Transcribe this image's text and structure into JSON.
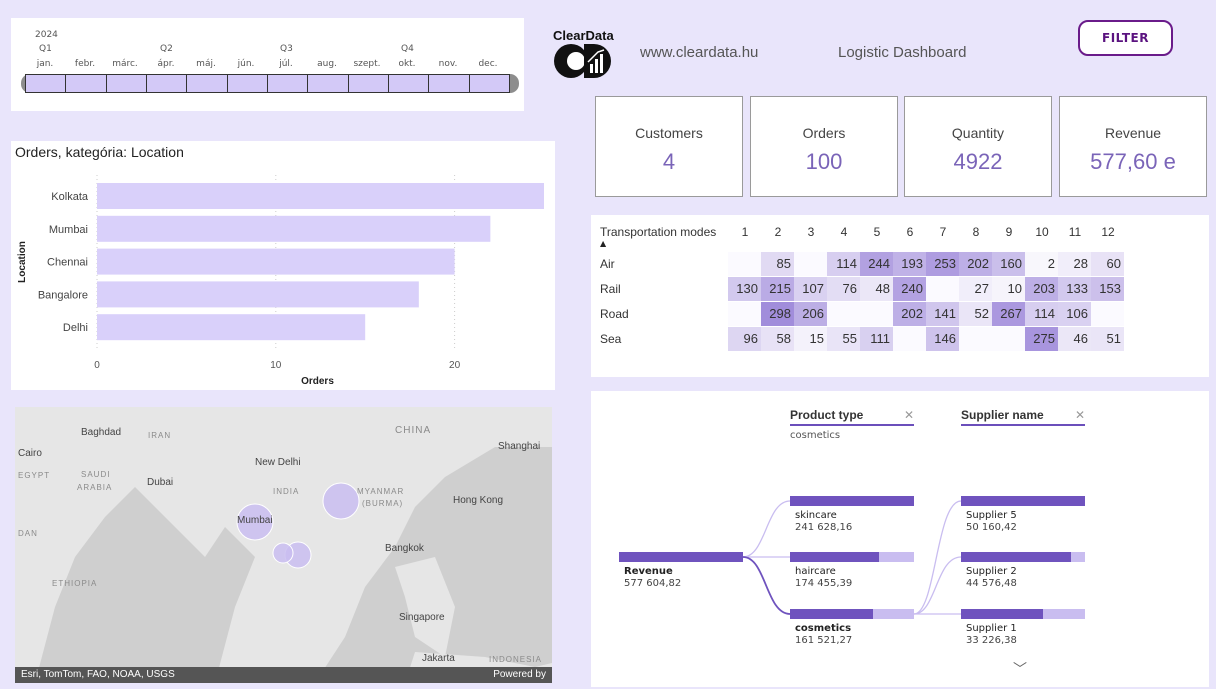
{
  "timeline": {
    "year": "2024",
    "quarters": [
      "Q1",
      "Q2",
      "Q3",
      "Q4"
    ],
    "months": [
      "jan.",
      "febr.",
      "márc.",
      "ápr.",
      "máj.",
      "jún.",
      "júl.",
      "aug.",
      "szept.",
      "okt.",
      "nov.",
      "dec."
    ]
  },
  "header": {
    "logo_text": "ClearData",
    "url": "www.cleardata.hu",
    "title": "Logistic Dashboard",
    "filter_label": "FILTER"
  },
  "kpis": [
    {
      "label": "Customers",
      "value": "4"
    },
    {
      "label": "Orders",
      "value": "100"
    },
    {
      "label": "Quantity",
      "value": "4922"
    },
    {
      "label": "Revenue",
      "value": "577,60 e"
    }
  ],
  "chart_data": {
    "type": "bar",
    "orientation": "horizontal",
    "title": "Orders, kategória: Location",
    "xlabel": "Orders",
    "ylabel": "Location",
    "categories": [
      "Kolkata",
      "Mumbai",
      "Chennai",
      "Bangalore",
      "Delhi"
    ],
    "values": [
      25,
      22,
      20,
      18,
      15
    ],
    "xlim": [
      0,
      25
    ],
    "xticks": [
      "0",
      "10",
      "20"
    ],
    "grid": true,
    "bar_color": "#d9d0fa"
  },
  "heatmap": {
    "header_label": "Transportation modes",
    "columns": [
      "1",
      "2",
      "3",
      "4",
      "5",
      "6",
      "7",
      "8",
      "9",
      "10",
      "11",
      "12"
    ],
    "rows": [
      {
        "label": "Air",
        "values": [
          "",
          "85",
          "",
          "114",
          "244",
          "193",
          "253",
          "202",
          "160",
          "2",
          "28",
          "60"
        ]
      },
      {
        "label": "Rail",
        "values": [
          "130",
          "215",
          "107",
          "76",
          "48",
          "240",
          "",
          "27",
          "10",
          "203",
          "133",
          "153"
        ]
      },
      {
        "label": "Road",
        "values": [
          "",
          "298",
          "206",
          "",
          "",
          "202",
          "141",
          "52",
          "267",
          "114",
          "106",
          ""
        ]
      },
      {
        "label": "Sea",
        "values": [
          "96",
          "58",
          "15",
          "55",
          "111",
          "",
          "146",
          "",
          "",
          "275",
          "46",
          "51"
        ]
      }
    ]
  },
  "map": {
    "labels": {
      "baghdad": "Baghdad",
      "iran": "IRAN",
      "china": "CHINA",
      "cairo": "Cairo",
      "egypt": "EGYPT",
      "saudi": "SAUDI",
      "arabia": "ARABIA",
      "dubai": "Dubai",
      "new_delhi": "New Delhi",
      "india": "INDIA",
      "myanmar": "MYANMAR",
      "burma": "(BURMA)",
      "shanghai": "Shanghai",
      "hong_kong": "Hong Kong",
      "mumbai": "Mumbai",
      "dan": "DAN",
      "ethiopia": "ETHIOPIA",
      "bangkok": "Bangkok",
      "singapore": "Singapore",
      "jakarta": "Jakarta",
      "indonesia": "INDONESIA"
    },
    "attribution": "Esri, TomTom, FAO, NOAA, USGS",
    "powered_by": "Powered by"
  },
  "tree": {
    "filters": [
      {
        "label": "Product type",
        "selected": "cosmetics"
      },
      {
        "label": "Supplier name",
        "selected": ""
      }
    ],
    "root": {
      "name": "Revenue",
      "value": "577 604,82"
    },
    "level1": [
      {
        "name": "skincare",
        "value": "241 628,16",
        "share": 1.0
      },
      {
        "name": "haircare",
        "value": "174 455,39",
        "share": 0.72
      },
      {
        "name": "cosmetics",
        "value": "161 521,27",
        "share": 0.67
      }
    ],
    "level2": [
      {
        "name": "Supplier 5",
        "value": "50 160,42",
        "share": 1.0
      },
      {
        "name": "Supplier 2",
        "value": "44 576,48",
        "share": 0.89
      },
      {
        "name": "Supplier 1",
        "value": "33 226,38",
        "share": 0.66
      }
    ]
  }
}
